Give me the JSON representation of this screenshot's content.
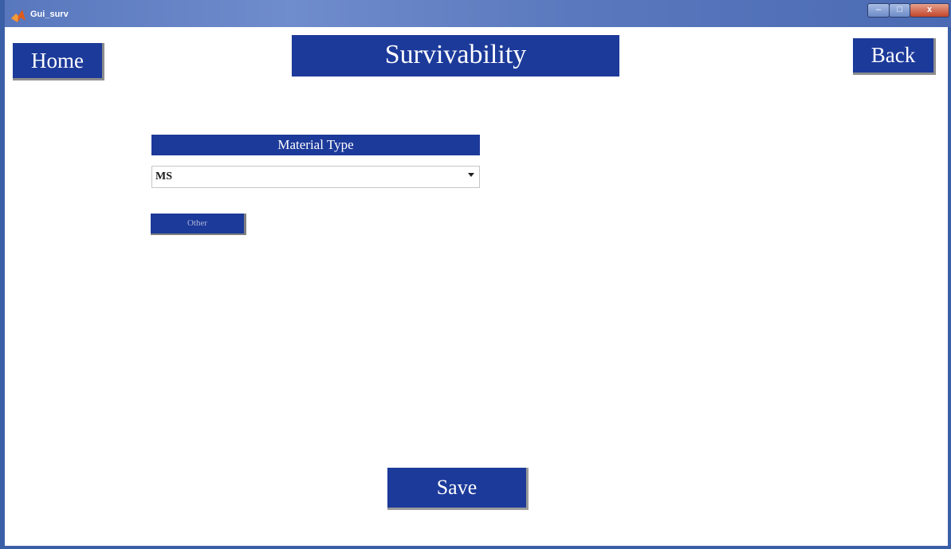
{
  "window": {
    "title": "Gui_surv",
    "app_icon": "matlab-icon",
    "controls": {
      "minimize": "–",
      "maximize": "□",
      "close": "x"
    },
    "accent_color": "#1c3a9a"
  },
  "nav": {
    "home_label": "Home",
    "back_label": "Back"
  },
  "page": {
    "heading": "Survivability"
  },
  "material": {
    "label": "Material Type",
    "selected": "MS",
    "other_label": "Other"
  },
  "actions": {
    "save_label": "Save"
  }
}
